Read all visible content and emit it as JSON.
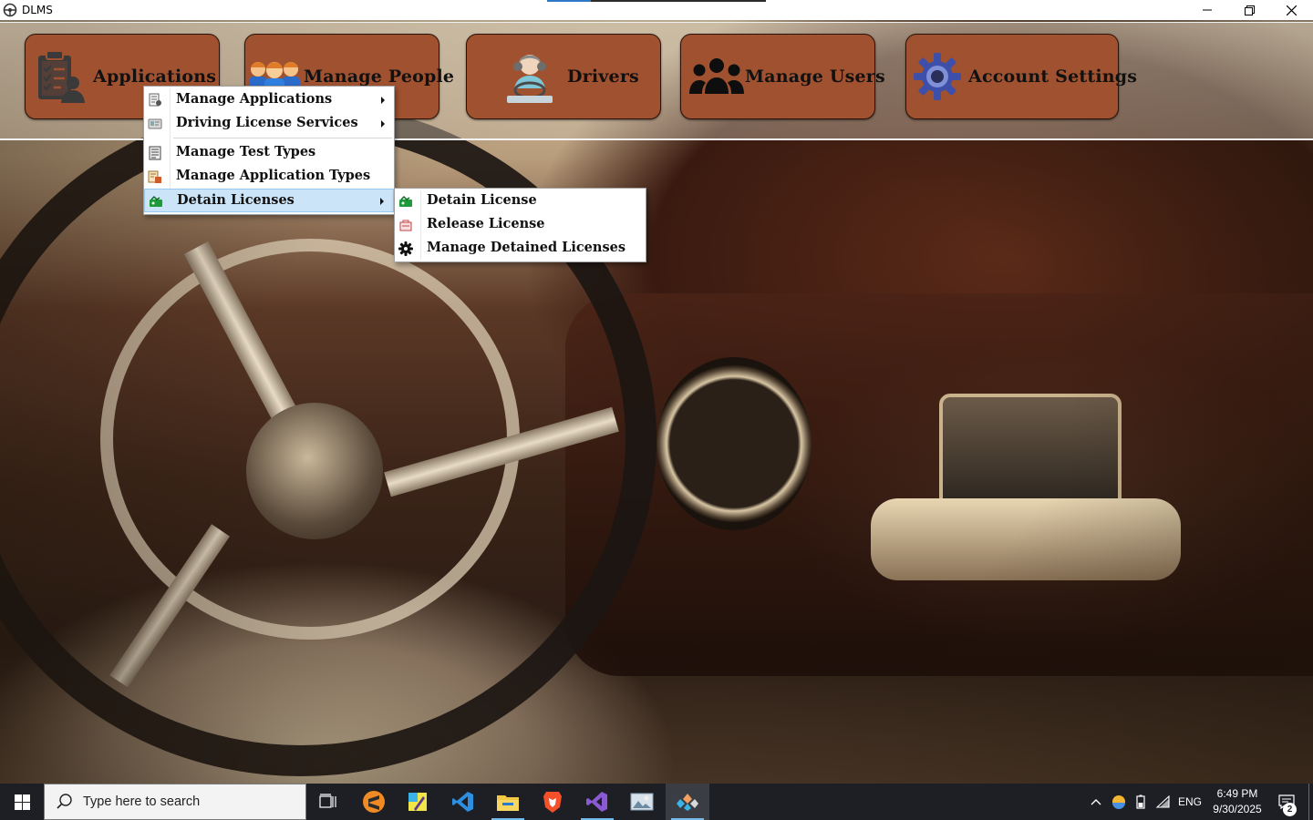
{
  "window": {
    "title": "DLMS",
    "icons": {
      "app": "steering-wheel-icon",
      "minimize": "minimize-icon",
      "maximize": "restore-icon",
      "close": "close-icon"
    }
  },
  "toolbar": {
    "buttons": [
      {
        "label": "Applications",
        "icon": "clipboard-user-icon"
      },
      {
        "label": "Manage People",
        "icon": "people-group-icon"
      },
      {
        "label": "Drivers",
        "icon": "driver-icon"
      },
      {
        "label": "Manage Users",
        "icon": "users-icon"
      },
      {
        "label": "Account Settings",
        "icon": "gear-icon"
      }
    ]
  },
  "applications_menu": {
    "items": [
      {
        "label": "Manage Applications",
        "icon": "applications-icon",
        "has_submenu": true
      },
      {
        "label": "Driving License Services",
        "icon": "license-services-icon",
        "has_submenu": true
      },
      {
        "label": "Manage Test Types",
        "icon": "test-types-icon",
        "has_submenu": false
      },
      {
        "label": "Manage Application Types",
        "icon": "application-types-icon",
        "has_submenu": false
      },
      {
        "label": "Detain Licenses",
        "icon": "detain-icon",
        "has_submenu": true,
        "selected": true
      }
    ]
  },
  "detain_submenu": {
    "items": [
      {
        "label": "Detain License",
        "icon": "detain-license-icon"
      },
      {
        "label": "Release License",
        "icon": "release-license-icon"
      },
      {
        "label": "Manage Detained Licenses",
        "icon": "gear-icon"
      }
    ]
  },
  "taskbar": {
    "search_placeholder": "Type here to search",
    "apps": [
      "task-view-icon",
      "sublime-text-icon",
      "paint-icon",
      "vscode-icon",
      "file-explorer-icon",
      "brave-icon",
      "visual-studio-icon",
      "photos-icon",
      "dlms-app-icon"
    ],
    "tray": {
      "language": "ENG",
      "time": "6:49 PM",
      "date": "9/30/2025",
      "notifications": "2"
    }
  },
  "colors": {
    "button_fill": "#a0512f",
    "menu_selected": "#cce4f7",
    "taskbar": "#1d1f25",
    "running_indicator": "#76b9ed"
  }
}
